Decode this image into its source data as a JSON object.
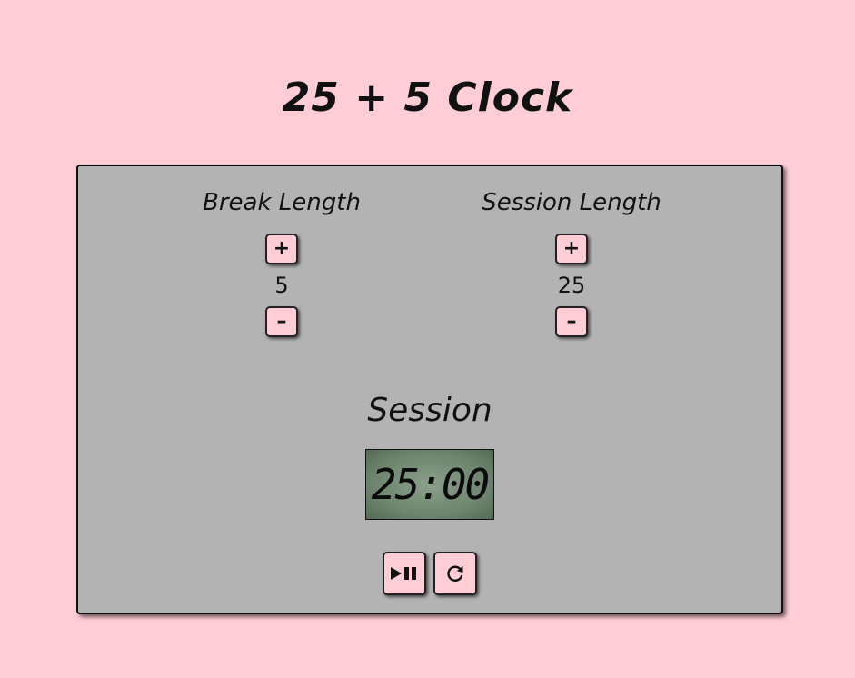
{
  "app": {
    "title": "25 + 5 Clock"
  },
  "break": {
    "label": "Break Length",
    "value": "5",
    "increment_label": "+",
    "decrement_label": "–"
  },
  "session": {
    "label": "Session Length",
    "value": "25",
    "increment_label": "+",
    "decrement_label": "–"
  },
  "timer": {
    "label": "Session",
    "time_left": "25:00"
  },
  "controls": {
    "start_stop_icon": "play-pause-icon",
    "reset_icon": "refresh-icon"
  },
  "colors": {
    "background": "#ffcdd6",
    "panel": "#b3b3b3",
    "button": "#ffcdd6",
    "lcd": "#6c836d"
  }
}
